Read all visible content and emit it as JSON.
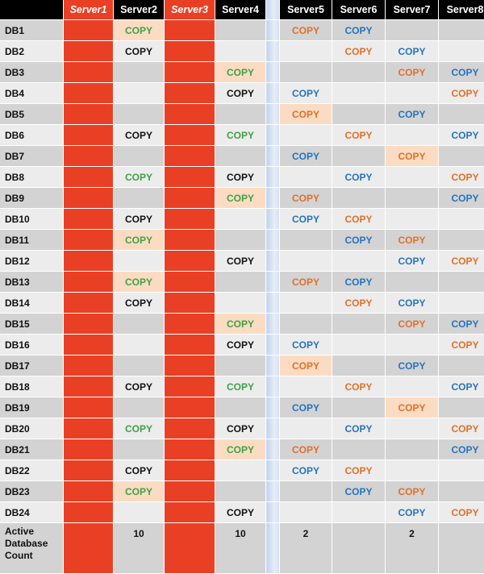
{
  "colors": {
    "header_bg": "#000000",
    "offline_server": "#e94025",
    "highlight": "#fbdcc2",
    "row_dark": "#d3d3d3",
    "row_light": "#ececec",
    "black": "#111111",
    "green": "#3fa146",
    "orange": "#e0702a",
    "blue": "#2673bd"
  },
  "headers": [
    "",
    "Server1",
    "Server2",
    "Server3",
    "Server4",
    "",
    "Server5",
    "Server6",
    "Server7",
    "Server8"
  ],
  "offline_servers": [
    "Server1",
    "Server3"
  ],
  "cell_text": "COPY",
  "rows": [
    {
      "label": "DB1",
      "cells": [
        null,
        {
          "c": "green",
          "hl": true
        },
        null,
        null,
        {
          "c": "orange"
        },
        {
          "c": "blue"
        },
        null,
        null
      ]
    },
    {
      "label": "DB2",
      "cells": [
        null,
        {
          "c": "black"
        },
        null,
        null,
        null,
        {
          "c": "orange"
        },
        {
          "c": "blue"
        },
        null
      ]
    },
    {
      "label": "DB3",
      "cells": [
        null,
        null,
        null,
        {
          "c": "green",
          "hl": true
        },
        null,
        null,
        {
          "c": "orange"
        },
        {
          "c": "blue"
        }
      ]
    },
    {
      "label": "DB4",
      "cells": [
        null,
        null,
        null,
        {
          "c": "black"
        },
        {
          "c": "blue"
        },
        null,
        null,
        {
          "c": "orange"
        }
      ]
    },
    {
      "label": "DB5",
      "cells": [
        null,
        null,
        null,
        null,
        {
          "c": "orange",
          "hl": true
        },
        null,
        {
          "c": "blue"
        },
        null
      ]
    },
    {
      "label": "DB6",
      "cells": [
        null,
        {
          "c": "black"
        },
        null,
        {
          "c": "green"
        },
        null,
        {
          "c": "orange"
        },
        null,
        {
          "c": "blue"
        }
      ]
    },
    {
      "label": "DB7",
      "cells": [
        null,
        null,
        null,
        null,
        {
          "c": "blue"
        },
        null,
        {
          "c": "orange",
          "hl": true
        },
        null
      ]
    },
    {
      "label": "DB8",
      "cells": [
        null,
        {
          "c": "green"
        },
        null,
        {
          "c": "black"
        },
        null,
        {
          "c": "blue"
        },
        null,
        {
          "c": "orange"
        }
      ]
    },
    {
      "label": "DB9",
      "cells": [
        null,
        null,
        null,
        {
          "c": "green",
          "hl": true
        },
        {
          "c": "orange"
        },
        null,
        null,
        {
          "c": "blue"
        }
      ]
    },
    {
      "label": "DB10",
      "cells": [
        null,
        {
          "c": "black"
        },
        null,
        null,
        {
          "c": "blue"
        },
        {
          "c": "orange"
        },
        null,
        null
      ]
    },
    {
      "label": "DB11",
      "cells": [
        null,
        {
          "c": "green",
          "hl": true
        },
        null,
        null,
        null,
        {
          "c": "blue"
        },
        {
          "c": "orange"
        },
        null
      ]
    },
    {
      "label": "DB12",
      "cells": [
        null,
        null,
        null,
        {
          "c": "black"
        },
        null,
        null,
        {
          "c": "blue"
        },
        {
          "c": "orange"
        }
      ]
    },
    {
      "label": "DB13",
      "cells": [
        null,
        {
          "c": "green",
          "hl": true
        },
        null,
        null,
        {
          "c": "orange"
        },
        {
          "c": "blue"
        },
        null,
        null
      ]
    },
    {
      "label": "DB14",
      "cells": [
        null,
        {
          "c": "black"
        },
        null,
        null,
        null,
        {
          "c": "orange"
        },
        {
          "c": "blue"
        },
        null
      ]
    },
    {
      "label": "DB15",
      "cells": [
        null,
        null,
        null,
        {
          "c": "green",
          "hl": true
        },
        null,
        null,
        {
          "c": "orange"
        },
        {
          "c": "blue"
        }
      ]
    },
    {
      "label": "DB16",
      "cells": [
        null,
        null,
        null,
        {
          "c": "black"
        },
        {
          "c": "blue"
        },
        null,
        null,
        {
          "c": "orange"
        }
      ]
    },
    {
      "label": "DB17",
      "cells": [
        null,
        null,
        null,
        null,
        {
          "c": "orange",
          "hl": true
        },
        null,
        {
          "c": "blue"
        },
        null
      ]
    },
    {
      "label": "DB18",
      "cells": [
        null,
        {
          "c": "black"
        },
        null,
        {
          "c": "green"
        },
        null,
        {
          "c": "orange"
        },
        null,
        {
          "c": "blue"
        }
      ]
    },
    {
      "label": "DB19",
      "cells": [
        null,
        null,
        null,
        null,
        {
          "c": "blue"
        },
        null,
        {
          "c": "orange",
          "hl": true
        },
        null
      ]
    },
    {
      "label": "DB20",
      "cells": [
        null,
        {
          "c": "green"
        },
        null,
        {
          "c": "black"
        },
        null,
        {
          "c": "blue"
        },
        null,
        {
          "c": "orange"
        }
      ]
    },
    {
      "label": "DB21",
      "cells": [
        null,
        null,
        null,
        {
          "c": "green",
          "hl": true
        },
        {
          "c": "orange"
        },
        null,
        null,
        {
          "c": "blue"
        }
      ]
    },
    {
      "label": "DB22",
      "cells": [
        null,
        {
          "c": "black"
        },
        null,
        null,
        {
          "c": "blue"
        },
        {
          "c": "orange"
        },
        null,
        null
      ]
    },
    {
      "label": "DB23",
      "cells": [
        null,
        {
          "c": "green",
          "hl": true
        },
        null,
        null,
        null,
        {
          "c": "blue"
        },
        {
          "c": "orange"
        },
        null
      ]
    },
    {
      "label": "DB24",
      "cells": [
        null,
        null,
        null,
        {
          "c": "black"
        },
        null,
        null,
        {
          "c": "blue"
        },
        {
          "c": "orange"
        }
      ]
    }
  ],
  "count_row": {
    "label": "Active Database Count",
    "values": [
      "",
      "10",
      "",
      "10",
      "2",
      "",
      "2",
      ""
    ]
  }
}
